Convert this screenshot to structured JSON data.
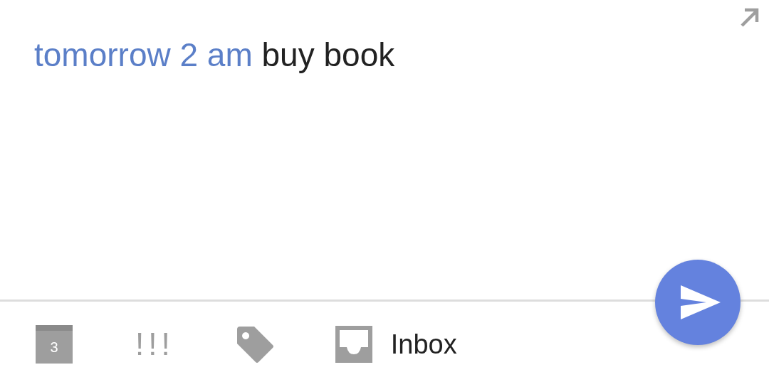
{
  "composer": {
    "parts": [
      {
        "text": "tomorrow 2 am",
        "kind": "detected"
      },
      {
        "text": "buy book",
        "kind": "plain"
      }
    ]
  },
  "toolbar": {
    "date_day": "3",
    "priority": "!!!",
    "folder": "Inbox"
  }
}
